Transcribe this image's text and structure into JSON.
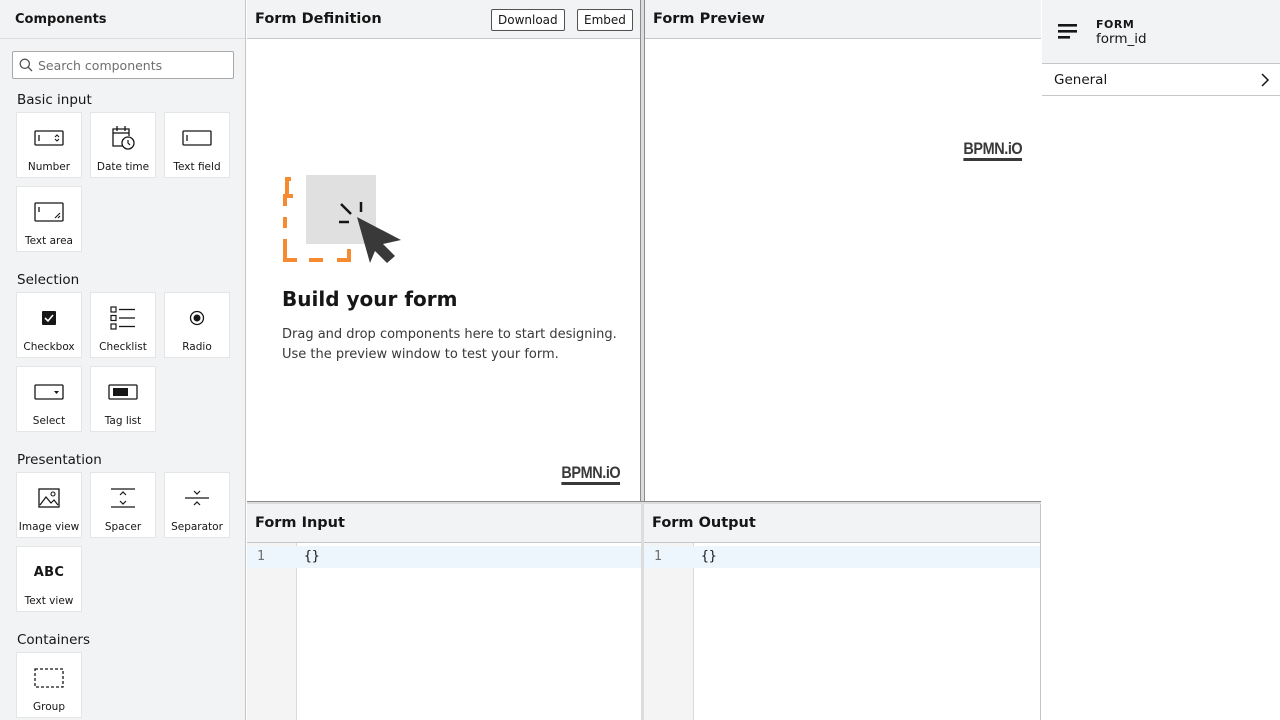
{
  "palette": {
    "title": "Components",
    "search_placeholder": "Search components",
    "groups": [
      {
        "title": "Basic input",
        "items": [
          {
            "label": "Number",
            "icon": "number-icon"
          },
          {
            "label": "Date time",
            "icon": "datetime-icon"
          },
          {
            "label": "Text field",
            "icon": "textfield-icon"
          },
          {
            "label": "Text area",
            "icon": "textarea-icon"
          }
        ]
      },
      {
        "title": "Selection",
        "items": [
          {
            "label": "Checkbox",
            "icon": "checkbox-icon"
          },
          {
            "label": "Checklist",
            "icon": "checklist-icon"
          },
          {
            "label": "Radio",
            "icon": "radio-icon"
          },
          {
            "label": "Select",
            "icon": "select-icon"
          },
          {
            "label": "Tag list",
            "icon": "taglist-icon"
          }
        ]
      },
      {
        "title": "Presentation",
        "items": [
          {
            "label": "Image view",
            "icon": "image-icon"
          },
          {
            "label": "Spacer",
            "icon": "spacer-icon"
          },
          {
            "label": "Separator",
            "icon": "separator-icon"
          },
          {
            "label": "Text view",
            "icon": "textview-icon",
            "glyph": "ABC"
          }
        ]
      },
      {
        "title": "Containers",
        "items": [
          {
            "label": "Group",
            "icon": "group-icon"
          }
        ]
      }
    ]
  },
  "definition": {
    "title": "Form Definition",
    "download_label": "Download",
    "embed_label": "Embed",
    "empty_title": "Build your form",
    "empty_line1": "Drag and drop components here to start designing.",
    "empty_line2": "Use the preview window to test your form.",
    "logo": "BPMN.iO"
  },
  "preview": {
    "title": "Form Preview",
    "logo": "BPMN.iO"
  },
  "input": {
    "title": "Form Input",
    "line_number": "1",
    "code": "{}"
  },
  "output": {
    "title": "Form Output",
    "line_number": "1",
    "code": "{}"
  },
  "properties": {
    "type": "FORM",
    "id": "form_id",
    "groups": [
      {
        "label": "General"
      }
    ]
  },
  "colors": {
    "accent_orange": "#f58a30",
    "panel_bg": "#f2f3f5",
    "active_line": "#edf5fd"
  }
}
